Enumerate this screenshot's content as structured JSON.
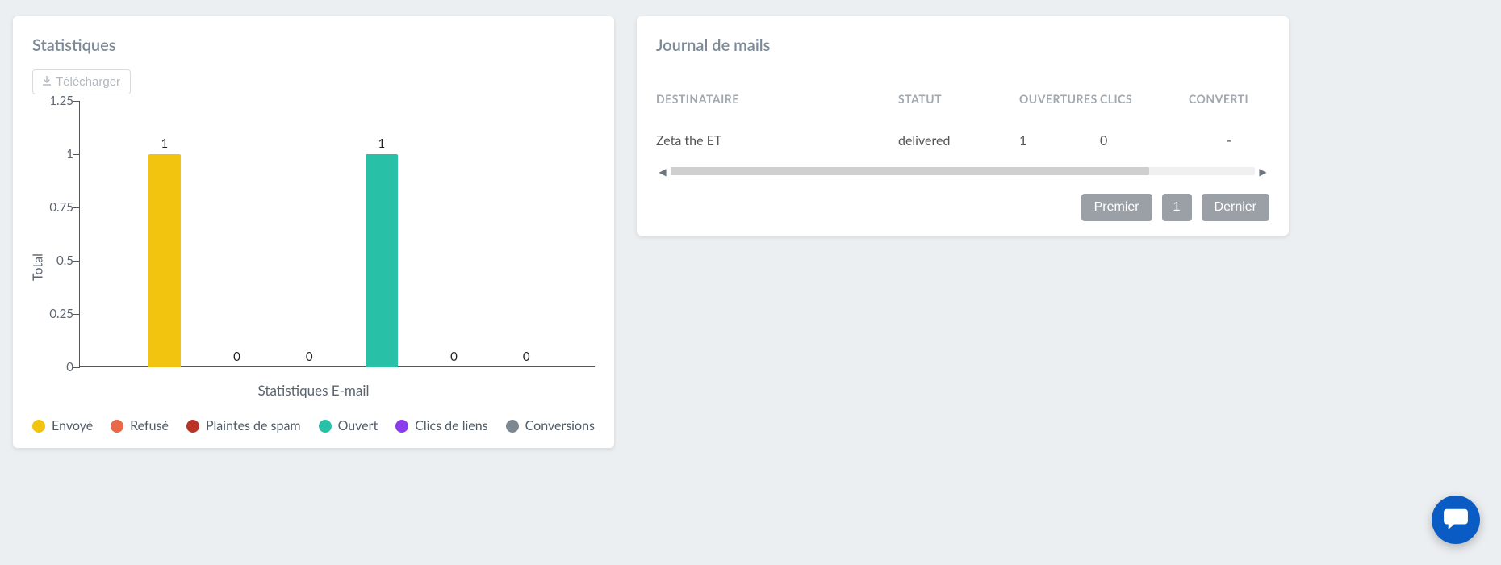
{
  "stats": {
    "title": "Statistiques",
    "download_label": "Télécharger"
  },
  "log": {
    "title": "Journal de mails",
    "headers": {
      "recipient": "DESTINATAIRE",
      "status": "STATUT",
      "opens": "OUVERTURES",
      "clicks": "CLICS",
      "converted": "CONVERTI"
    },
    "rows": [
      {
        "recipient": "Zeta the ET",
        "status": "delivered",
        "opens": "1",
        "clicks": "0",
        "converted": "-"
      }
    ],
    "pager": {
      "first": "Premier",
      "page": "1",
      "last": "Dernier"
    }
  },
  "chart_data": {
    "type": "bar",
    "title": "",
    "xlabel": "Statistiques E-mail",
    "ylabel": "Total",
    "ylim": [
      0,
      1.25
    ],
    "yticks": [
      0,
      0.25,
      0.5,
      0.75,
      1,
      1.25
    ],
    "categories": [
      "Envoyé",
      "Refusé",
      "Plaintes de spam",
      "Ouvert",
      "Clics de liens",
      "Conversions"
    ],
    "values": [
      1,
      0,
      0,
      1,
      0,
      0
    ],
    "colors": [
      "#f2c30f",
      "#e8684a",
      "#b93427",
      "#28c0a6",
      "#8a3eeb",
      "#7d8790"
    ],
    "legend": [
      {
        "name": "Envoyé",
        "color": "#f2c30f"
      },
      {
        "name": "Refusé",
        "color": "#e8684a"
      },
      {
        "name": "Plaintes de spam",
        "color": "#b93427"
      },
      {
        "name": "Ouvert",
        "color": "#28c0a6"
      },
      {
        "name": "Clics de liens",
        "color": "#8a3eeb"
      },
      {
        "name": "Conversions",
        "color": "#7d8790"
      }
    ]
  }
}
